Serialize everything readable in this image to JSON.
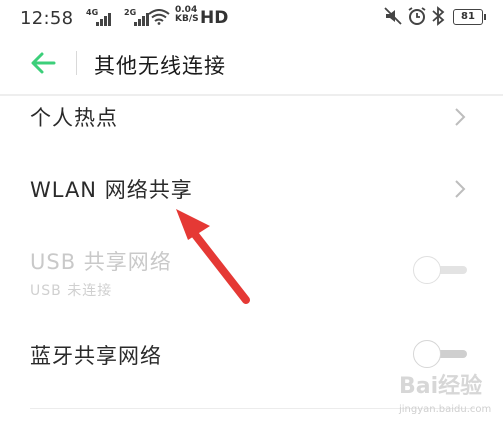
{
  "status_bar": {
    "time": "12:58",
    "sim1_label": "4G",
    "sim2_label": "2G",
    "net_speed_value": "0.04",
    "net_speed_unit": "KB/S",
    "hd_label": "HD",
    "battery": "81",
    "icons": [
      "mute-icon",
      "alarm-icon",
      "bluetooth-icon"
    ]
  },
  "header": {
    "back_icon": "back-arrow-icon",
    "title": "其他无线连接"
  },
  "items": [
    {
      "label": "个人热点",
      "control": "chevron",
      "enabled": true
    },
    {
      "label": "WLAN 网络共享",
      "control": "chevron",
      "enabled": true
    },
    {
      "label": "USB 共享网络",
      "sublabel": "USB 未连接",
      "control": "toggle",
      "state": "off",
      "enabled": false
    },
    {
      "label": "蓝牙共享网络",
      "control": "toggle",
      "state": "off",
      "enabled": true
    }
  ],
  "annotation": {
    "type": "arrow",
    "color": "#e53935"
  },
  "watermark": {
    "text": "Bai经验",
    "url": "jingyan.baidu.com"
  },
  "colors": {
    "accent": "#3ccf7a",
    "annotation": "#e53935"
  }
}
